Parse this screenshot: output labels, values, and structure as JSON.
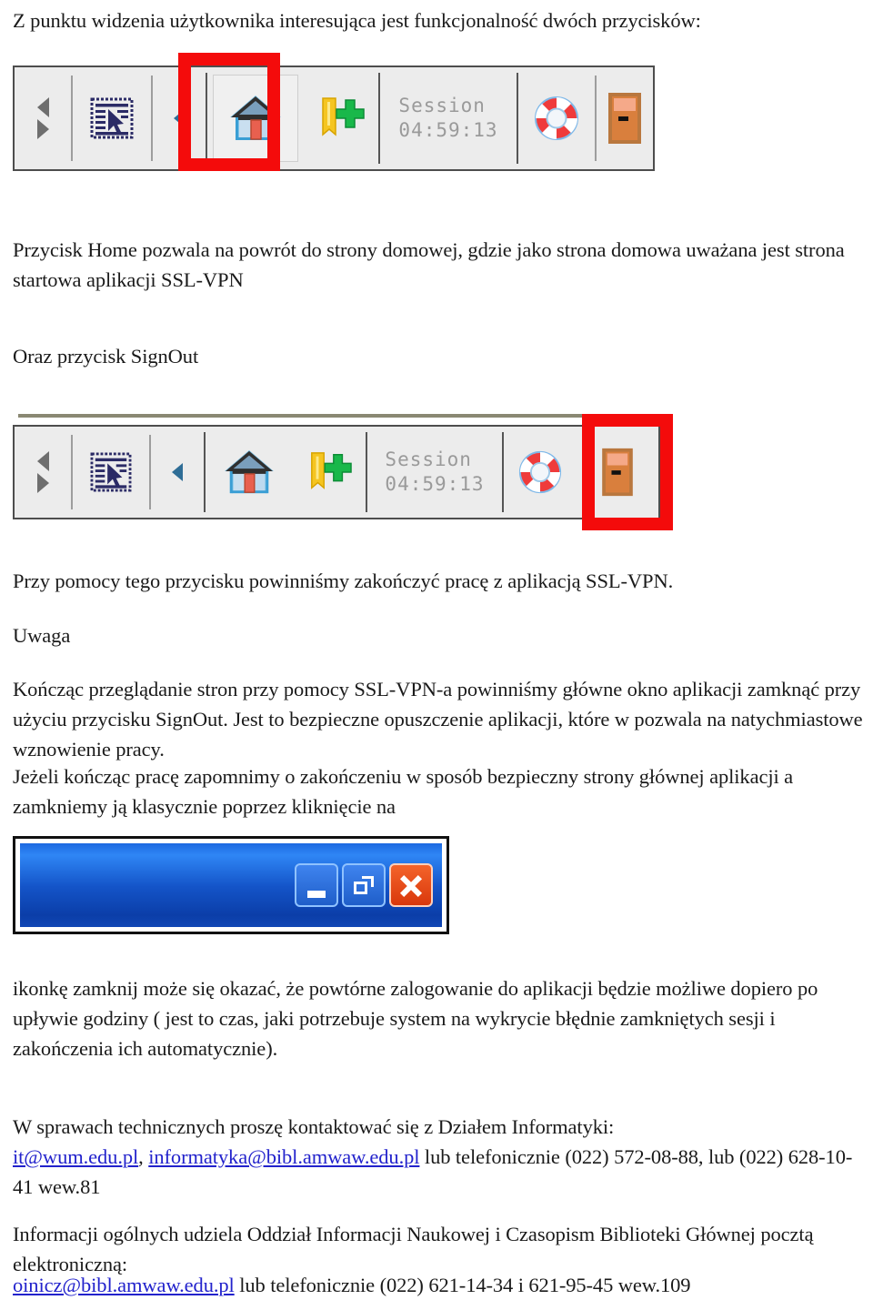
{
  "document": {
    "intro_line": "Z punktu widzenia użytkownika interesująca jest funkcjonalność dwóch przycisków:",
    "home_description": "Przycisk Home pozwala na powrót do strony domowej, gdzie jako strona domowa uważana jest strona startowa aplikacji SSL-VPN",
    "signout_heading": "Oraz przycisk SignOut",
    "signout_description": "Przy pomocy tego przycisku powinniśmy zakończyć pracę z aplikacją SSL-VPN.",
    "note_label": "Uwaga",
    "note_body": "Kończąc przeglądanie stron przy pomocy SSL-VPN-a powinniśmy główne okno aplikacji zamknąć przy użyciu przycisku SignOut. Jest to bezpieczne opuszczenie aplikacji, które w pozwala na natychmiastowe wznowienie pracy.",
    "warning_body": "Jeżeli kończąc pracę zapomnimy o zakończeniu w sposób bezpieczny strony głównej aplikacji a zamkniemy ją klasycznie poprzez kliknięcie na",
    "after_image_body": " ikonkę zamknij może się okazać, że powtórne zalogowanie do aplikacji będzie możliwe dopiero po upływie godziny ( jest to czas, jaki potrzebuje system na wykrycie błędnie zamkniętych sesji i zakończenia ich automatycznie).",
    "contact_heading": "W sprawach technicznych proszę kontaktować się z Działem Informatyki:",
    "contact_email_1": "it@wum.edu.pl",
    "contact_sep_1": ", ",
    "contact_email_2": "informatyka@bibl.amwaw.edu.pl",
    "contact_phone_tail": " lub telefonicznie (022) 572-08-88, lub (022) 628-10-41 wew.81",
    "info_heading": "Informacji ogólnych udziela Oddział Informacji Naukowej i Czasopism Biblioteki Głównej pocztą elektroniczną:",
    "info_email": "oinicz@bibl.amwaw.edu.pl",
    "info_phone_tail": " lub telefonicznie (022) 621-14-34 i 621-95-45 wew.109"
  },
  "toolbar": {
    "session_label": "Session",
    "session_time": "04:59:13",
    "icons": {
      "nav_back": "back-arrow-icon",
      "nav_forward": "forward-arrow-icon",
      "select_text": "text-select-icon",
      "collapse": "collapse-arrow-icon",
      "home": "home-icon",
      "bookmark_add": "add-bookmark-icon",
      "help": "life-preserver-help-icon",
      "signout": "signout-door-icon"
    },
    "highlight_color": "#f40b0b"
  },
  "window_buttons": {
    "minimize": "minimize-button",
    "maximize": "restore-button",
    "close": "close-button",
    "close_color": "#d9380c",
    "titlebar_color": "#1454c8"
  }
}
